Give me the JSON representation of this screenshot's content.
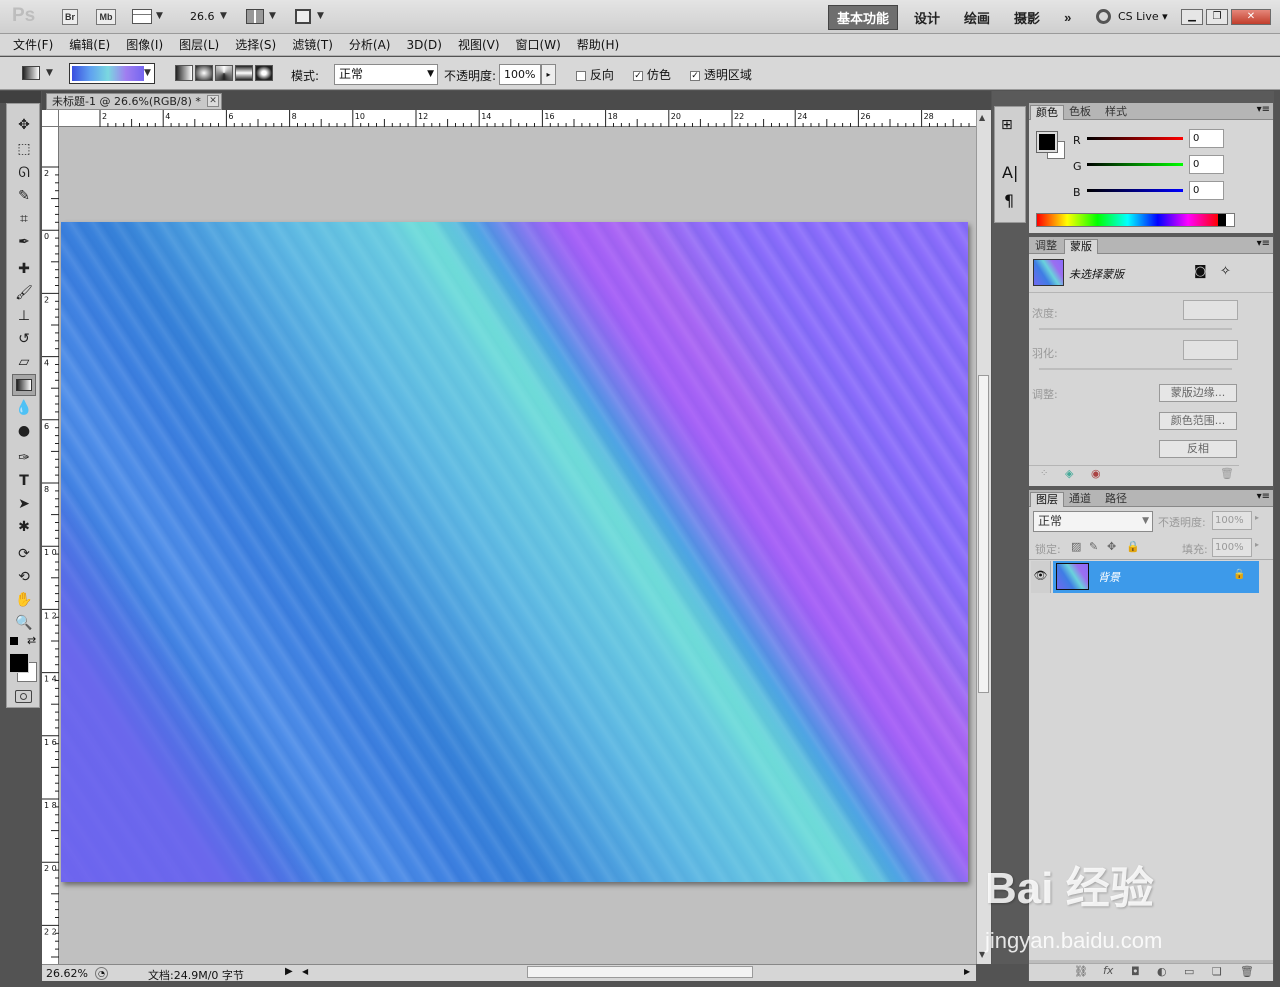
{
  "app": {
    "logo": "Ps",
    "bridge_label": "Br",
    "minibridge_label": "Mb",
    "zoom_value": "26.6",
    "workspaces": [
      "基本功能",
      "设计",
      "绘画",
      "摄影"
    ],
    "more": "»",
    "cs_live": "CS Live"
  },
  "menu": [
    "文件(F)",
    "编辑(E)",
    "图像(I)",
    "图层(L)",
    "选择(S)",
    "滤镜(T)",
    "分析(A)",
    "3D(D)",
    "视图(V)",
    "窗口(W)",
    "帮助(H)"
  ],
  "options": {
    "mode_label": "模式:",
    "mode_value": "正常",
    "opacity_label": "不透明度:",
    "opacity_value": "100%",
    "reverse_label": "反向",
    "reverse_checked": false,
    "dither_label": "仿色",
    "dither_checked": true,
    "transparency_label": "透明区域",
    "transparency_checked": true
  },
  "document": {
    "tab_title": "未标题-1 @ 26.6%(RGB/8) *",
    "ruler_top": [
      "2",
      "4",
      "6",
      "8",
      "10",
      "12",
      "14",
      "16",
      "18",
      "20",
      "22",
      "24",
      "26",
      "28"
    ],
    "ruler_left": [
      "2",
      "0",
      "2",
      "4",
      "6",
      "8",
      "1 0",
      "1 2",
      "1 4",
      "1 6",
      "1 8",
      "2 0",
      "2 2"
    ],
    "zoom_status": "26.62%",
    "doc_info": "文档:24.9M/0 字节"
  },
  "color_panel": {
    "tabs": [
      "颜色",
      "色板",
      "样式"
    ],
    "channels": [
      {
        "label": "R",
        "value": "0"
      },
      {
        "label": "G",
        "value": "0"
      },
      {
        "label": "B",
        "value": "0"
      }
    ]
  },
  "masks_panel": {
    "tabs": [
      "调整",
      "蒙版"
    ],
    "mask_title": "未选择蒙版",
    "density_label": "浓度:",
    "feather_label": "羽化:",
    "refine_label": "调整:",
    "buttons": [
      "蒙版边缘...",
      "颜色范围...",
      "反相"
    ]
  },
  "layers_panel": {
    "tabs": [
      "图层",
      "通道",
      "路径"
    ],
    "blend_mode": "正常",
    "opacity_label": "不透明度:",
    "opacity_value": "100%",
    "lock_label": "锁定:",
    "fill_label": "填充:",
    "fill_value": "100%",
    "layers": [
      {
        "name": "背景",
        "visible": true,
        "locked": true
      }
    ]
  },
  "watermark": {
    "brand": "Bai 经验",
    "url": "jingyan.baidu.com"
  }
}
